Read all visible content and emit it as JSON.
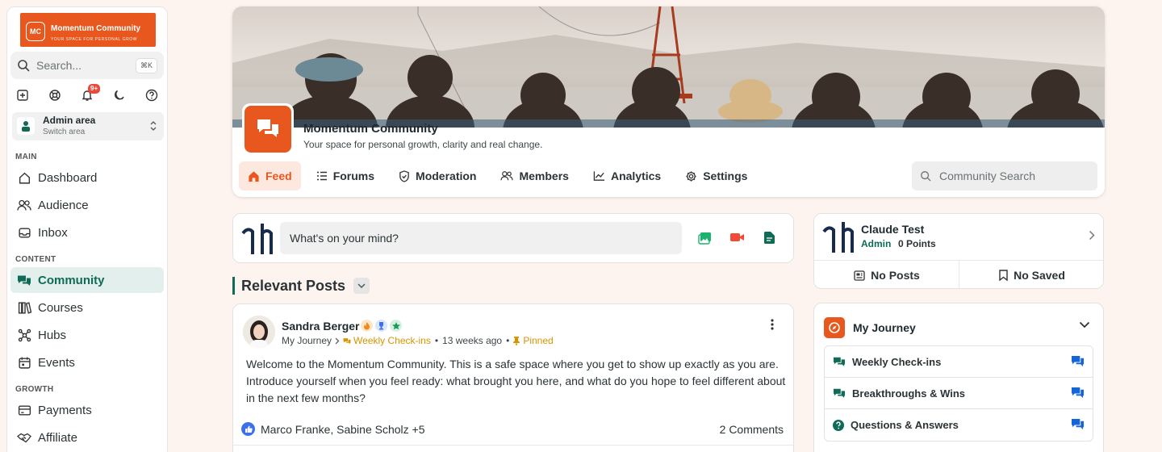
{
  "sidebar": {
    "logo_initials": "MC",
    "logo_name": "Momentum Community",
    "logo_tagline": "YOUR SPACE FOR PERSONAL GROW",
    "search_placeholder": "Search...",
    "search_shortcut": "⌘K",
    "notification_badge": "9+",
    "area_title": "Admin area",
    "area_subtitle": "Switch area",
    "sections": {
      "main": "MAIN",
      "content": "CONTENT",
      "growth": "GROWTH"
    },
    "items": {
      "dashboard": "Dashboard",
      "audience": "Audience",
      "inbox": "Inbox",
      "community": "Community",
      "courses": "Courses",
      "hubs": "Hubs",
      "events": "Events",
      "payments": "Payments",
      "affiliate": "Affiliate"
    }
  },
  "header": {
    "title": "Momentum Community",
    "subtitle": "Your space for personal growth, clarity and real change.",
    "tabs": {
      "feed": "Feed",
      "forums": "Forums",
      "moderation": "Moderation",
      "members": "Members",
      "analytics": "Analytics",
      "settings": "Settings"
    },
    "search_placeholder": "Community Search"
  },
  "composer": {
    "placeholder": "What's on your mind?"
  },
  "feed": {
    "heading": "Relevant Posts"
  },
  "post": {
    "author": "Sandra Berger",
    "journey": "My Journey",
    "forum": "Weekly Check-ins",
    "time": "13 weeks ago",
    "pinned": "Pinned",
    "body": "Welcome to the Momentum Community. This is a safe space where you get to show up exactly as you are. Introduce yourself when you feel ready: what brought you here, and what do you hope to feel different about in the next few months?",
    "reactions": "Marco Franke, Sabine Scholz +5",
    "comments": "2 Comments"
  },
  "user": {
    "name": "Claude Test",
    "role": "Admin",
    "points": "0 Points",
    "posts": "No Posts",
    "saved": "No Saved"
  },
  "journey": {
    "title": "My Journey",
    "items": [
      "Weekly Check-ins",
      "Breakthroughs & Wins",
      "Questions & Answers"
    ]
  },
  "colors": {
    "brand": "#e8571d",
    "accent": "#0f6b55",
    "background": "#fdf3ef"
  }
}
